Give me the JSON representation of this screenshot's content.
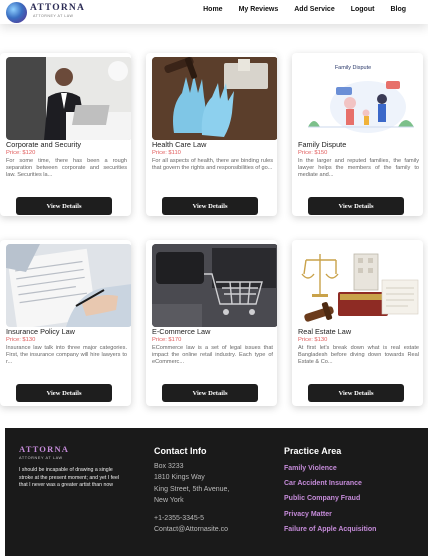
{
  "brand": {
    "name": "ATTORNA",
    "tagline": "ATTORNEY AT LAW"
  },
  "nav": [
    "Home",
    "My Reviews",
    "Add Service",
    "Logout",
    "Blog"
  ],
  "services": [
    {
      "title": "Corporate and Security",
      "price": "Price: $120",
      "desc": "For some time, there has been a rough separation between corporate and securities law. Securities la...",
      "button": "View Details",
      "image": "businessman-at-desk"
    },
    {
      "title": "Health Care Law",
      "price": "Price: $110",
      "desc": "For all aspects of health, there are binding rules that govern the rights and responsibilities of go...",
      "button": "View Details",
      "image": "gloves-and-gavel"
    },
    {
      "title": "Family Dispute",
      "price": "Price: $150",
      "desc": "In the larger and reputed families, the family lawyer helps the members of the family to mediate and...",
      "button": "View Details",
      "image": "family-dispute-illustration",
      "image_caption": "Family Dispute"
    },
    {
      "title": "Insurance Policy Law",
      "price": "Price: $130",
      "desc": "Insurance law talk into three major categories. First, the insurance company will hire lawyers to r...",
      "button": "View Details",
      "image": "signing-document"
    },
    {
      "title": "E-Commerce Law",
      "price": "Price: $170",
      "desc": "ECommerce law is a set of legal issues that impact the online retail industry. Each type of eCommerc...",
      "button": "View Details",
      "image": "cart-and-laptop"
    },
    {
      "title": "Real Estate Law",
      "price": "Price: $130",
      "desc": "At first let's break down what is real estate Bangladesh before diving down towards Real Estate & Co...",
      "button": "View Details",
      "image": "scales-gavel-house"
    }
  ],
  "footer": {
    "logo": "ATTORNA",
    "tagline": "ATTORNEY AT LAW",
    "quote": "I should be incapable of drawing a single stroke at the present moment; and yet I feel that I never was a greater artist than now",
    "contact_heading": "Contact Info",
    "contact_lines": [
      "Box 3233",
      "1810 Kings Way",
      "King Street, 5th Avenue,",
      "New York",
      "",
      "+1-2355-3345-5",
      "Contact@Attornasite.co"
    ],
    "practice_heading": "Practice Area",
    "practice_links": [
      "Family Violence",
      "Car Accident Insurance",
      "Public Company Fraud",
      "Privacy Matter",
      "Failure of Apple Acquisition"
    ]
  },
  "colors": {
    "price": "#e05a5a",
    "footer_bg": "#1a1a1a",
    "footer_accent": "#c58bd9",
    "button_bg": "#1e1e1e"
  }
}
